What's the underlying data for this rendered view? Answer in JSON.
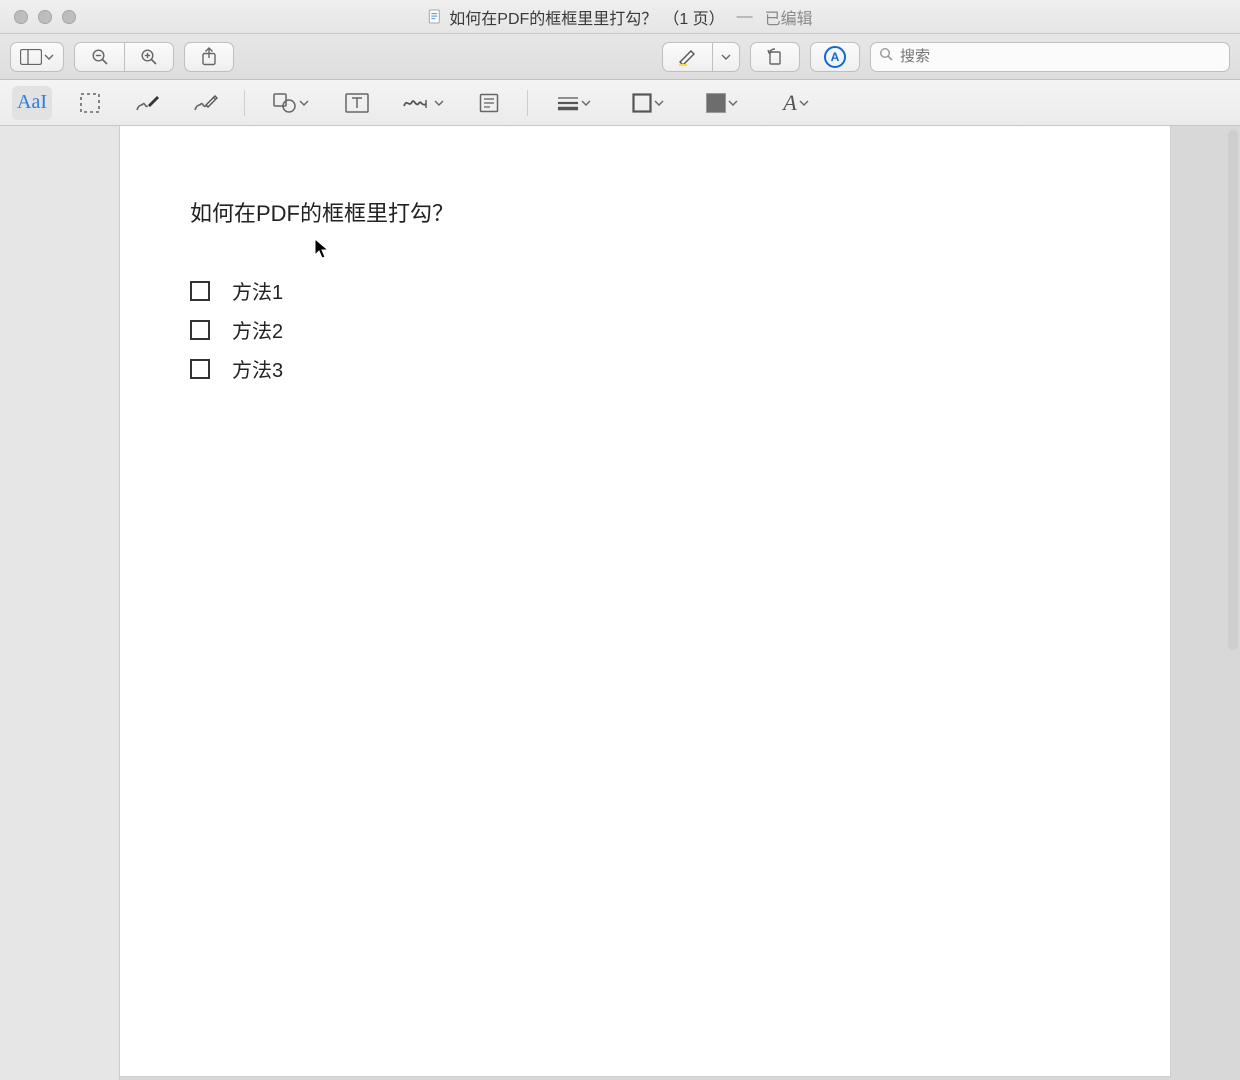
{
  "titlebar": {
    "doc_title": "如何在PDF的框框里里打勾？",
    "page_count": "（1 页）",
    "separator": "—",
    "edited_label": "已编辑"
  },
  "toolbar1": {
    "search_placeholder": "搜索",
    "markup_letter": "A"
  },
  "toolbar2": {
    "text_tool_label": "AaI"
  },
  "document": {
    "heading": "如何在PDF的框框里打勾？",
    "items": [
      {
        "label": "方法1"
      },
      {
        "label": "方法2"
      },
      {
        "label": "方法3"
      }
    ]
  }
}
